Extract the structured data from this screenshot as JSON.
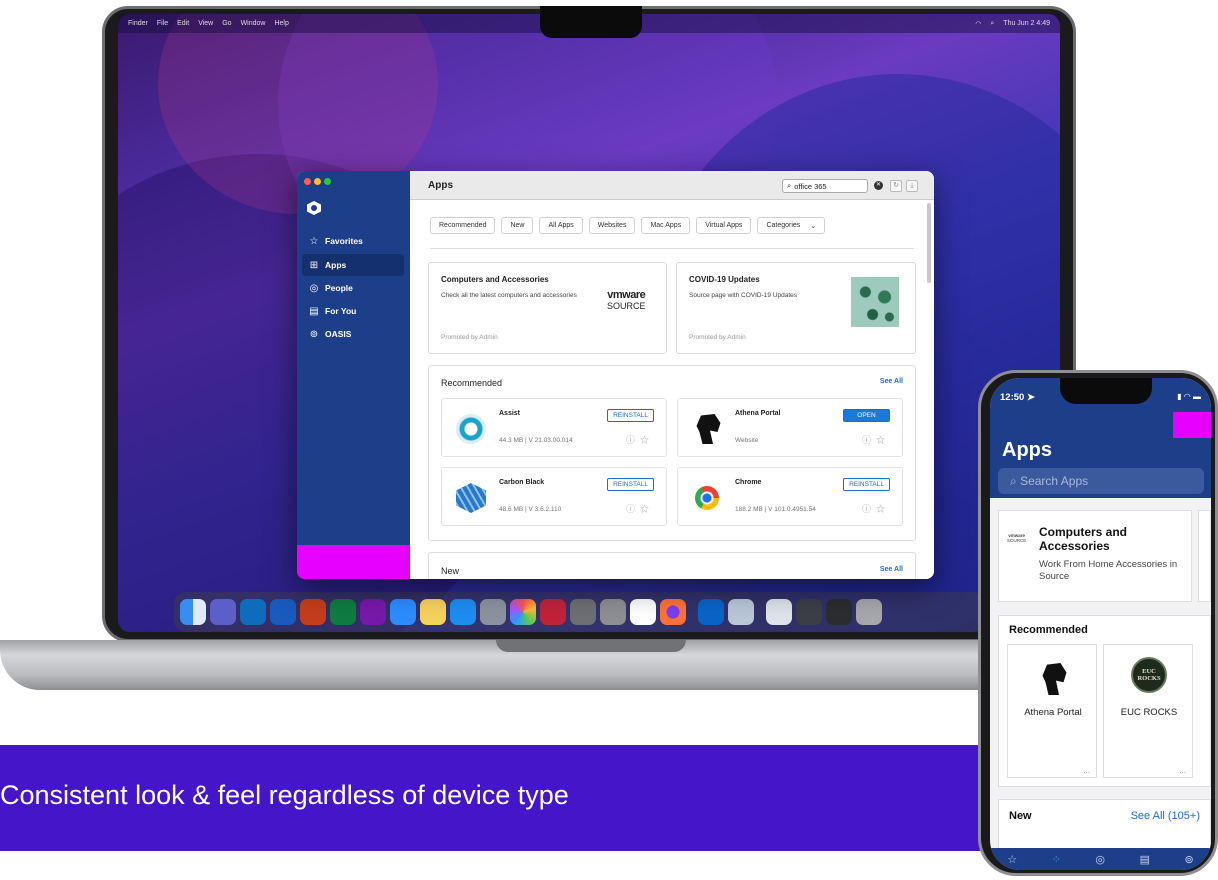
{
  "menubar": {
    "items": [
      "Finder",
      "File",
      "Edit",
      "View",
      "Go",
      "Window",
      "Help"
    ],
    "clock": "Thu Jun 2 4:49"
  },
  "app": {
    "sidebar": {
      "items": [
        {
          "label": "Favorites",
          "icon": "star-icon"
        },
        {
          "label": "Apps",
          "icon": "grid-icon"
        },
        {
          "label": "People",
          "icon": "person-icon"
        },
        {
          "label": "For You",
          "icon": "list-icon"
        },
        {
          "label": "OASIS",
          "icon": "lifebuoy-icon"
        }
      ]
    },
    "header": {
      "title": "Apps",
      "search_value": "office 365"
    },
    "filters": [
      "Recommended",
      "New",
      "All Apps",
      "Websites",
      "Mac Apps",
      "Virtual Apps",
      "Categories"
    ],
    "promos": [
      {
        "title": "Computers and Accessories",
        "desc": "Check all the latest computers and accessories",
        "promoted": "Promoted by Admin",
        "logo_top": "vmware",
        "logo_bottom": "SOURCE"
      },
      {
        "title": "COVID-19 Updates",
        "desc": "Source page with COVID-19 Updates",
        "promoted": "Promoted by Admin"
      }
    ],
    "recommended": {
      "title": "Recommended",
      "see_all": "See All",
      "apps": [
        {
          "name": "Assist",
          "meta": "44.3 MB  |  V 21.03.00.014",
          "action": "REINSTALL"
        },
        {
          "name": "Athena Portal",
          "meta": "Website",
          "action": "OPEN"
        },
        {
          "name": "Carbon Black",
          "meta": "48.6 MB  |  V 3.6.2.110",
          "action": "REINSTALL"
        },
        {
          "name": "Chrome",
          "meta": "188.2 MB  |  V 101.0.4951.54",
          "action": "REINSTALL"
        }
      ]
    },
    "new_section": {
      "title": "New",
      "see_all": "See All"
    }
  },
  "banner": {
    "text": "Consistent look & feel regardless of device type"
  },
  "phone": {
    "time": "12:50",
    "title": "Apps",
    "search_placeholder": "Search Apps",
    "promo": {
      "logo_top": "vmware",
      "logo_bottom": "SOURCE",
      "title": "Computers and Accessories",
      "desc": "Work From Home Accessories in Source"
    },
    "recommended": {
      "title": "Recommended",
      "apps": [
        {
          "name": "Athena Portal"
        },
        {
          "name": "EUC ROCKS",
          "logo": "EUC ROCKS"
        }
      ]
    },
    "new_section": {
      "title": "New",
      "see_all": "See All (105+)"
    }
  },
  "colors": {
    "sidebar": "#1d3f8a",
    "accent": "#1a6bd6",
    "banner": "#4415c9",
    "redaction": "#e600ff"
  }
}
